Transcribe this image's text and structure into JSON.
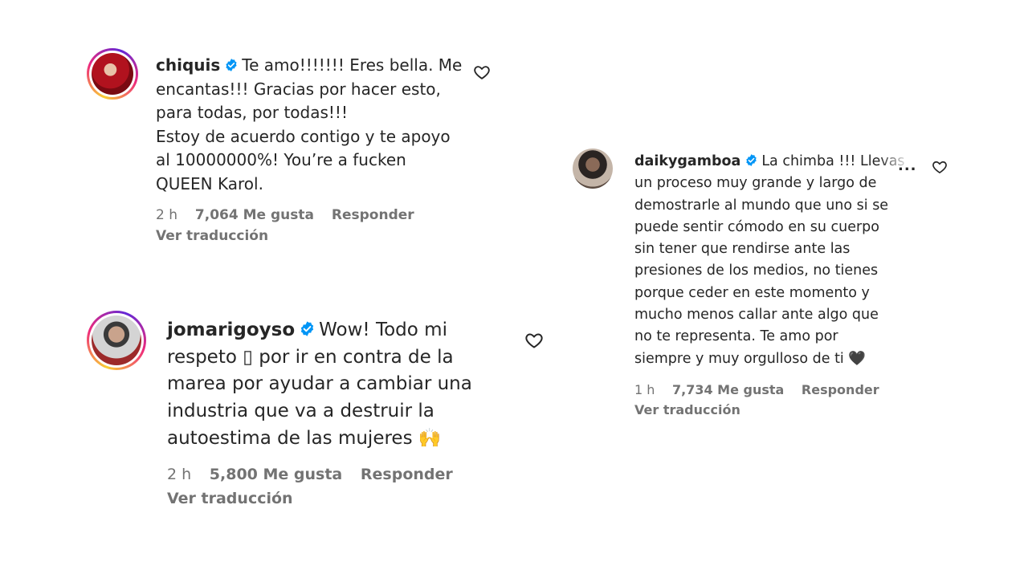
{
  "comments": [
    {
      "username": "chiquis",
      "text": "Te amo!!!!!!! Eres bella. Me\nencantas!!! Gracias por hacer esto,\npara todas, por todas!!!\nEstoy de acuerdo contigo y te apoyo\nal 10000000%! You’re a fucken\nQUEEN Karol.",
      "time": "2 h",
      "likes": "7,064 Me gusta",
      "reply": "Responder",
      "translate": "Ver traducción"
    },
    {
      "username": "jomarigoyso",
      "text_parts": [
        "Wow! Todo mi\nrespeto ",
        "▯",
        " por ir en contra de la\nmarea por ayudar a cambiar una\nindustria que va a destruir la\nautoestima de las mujeres "
      ],
      "emoji": "🙌",
      "time": "2 h",
      "likes": "5,800 Me gusta",
      "reply": "Responder",
      "translate": "Ver traducción"
    },
    {
      "username": "daikygamboa",
      "text_parts": [
        "La chimba !!! Llevas\nun proceso muy grande y largo de\ndemostrarle al mundo que uno si se\npuede sentir cómodo en su cuerpo\nsin tener que rendirse ante las\npresiones de los medios, no tienes\nporque ceder en este momento y\nmucho menos callar ante algo que\nno te representa. Te amo por\nsiempre y muy orgulloso de ti "
      ],
      "emoji": "🖤",
      "more": "...",
      "time": "1 h",
      "likes": "7,734 Me gusta",
      "reply": "Responder",
      "translate": "Ver traducción"
    }
  ],
  "colors": {
    "text": "#262626",
    "secondary": "#737373",
    "verified": "#0095f6"
  },
  "icons": [
    "verified-badge-icon",
    "heart-icon",
    "more-options-icon"
  ]
}
